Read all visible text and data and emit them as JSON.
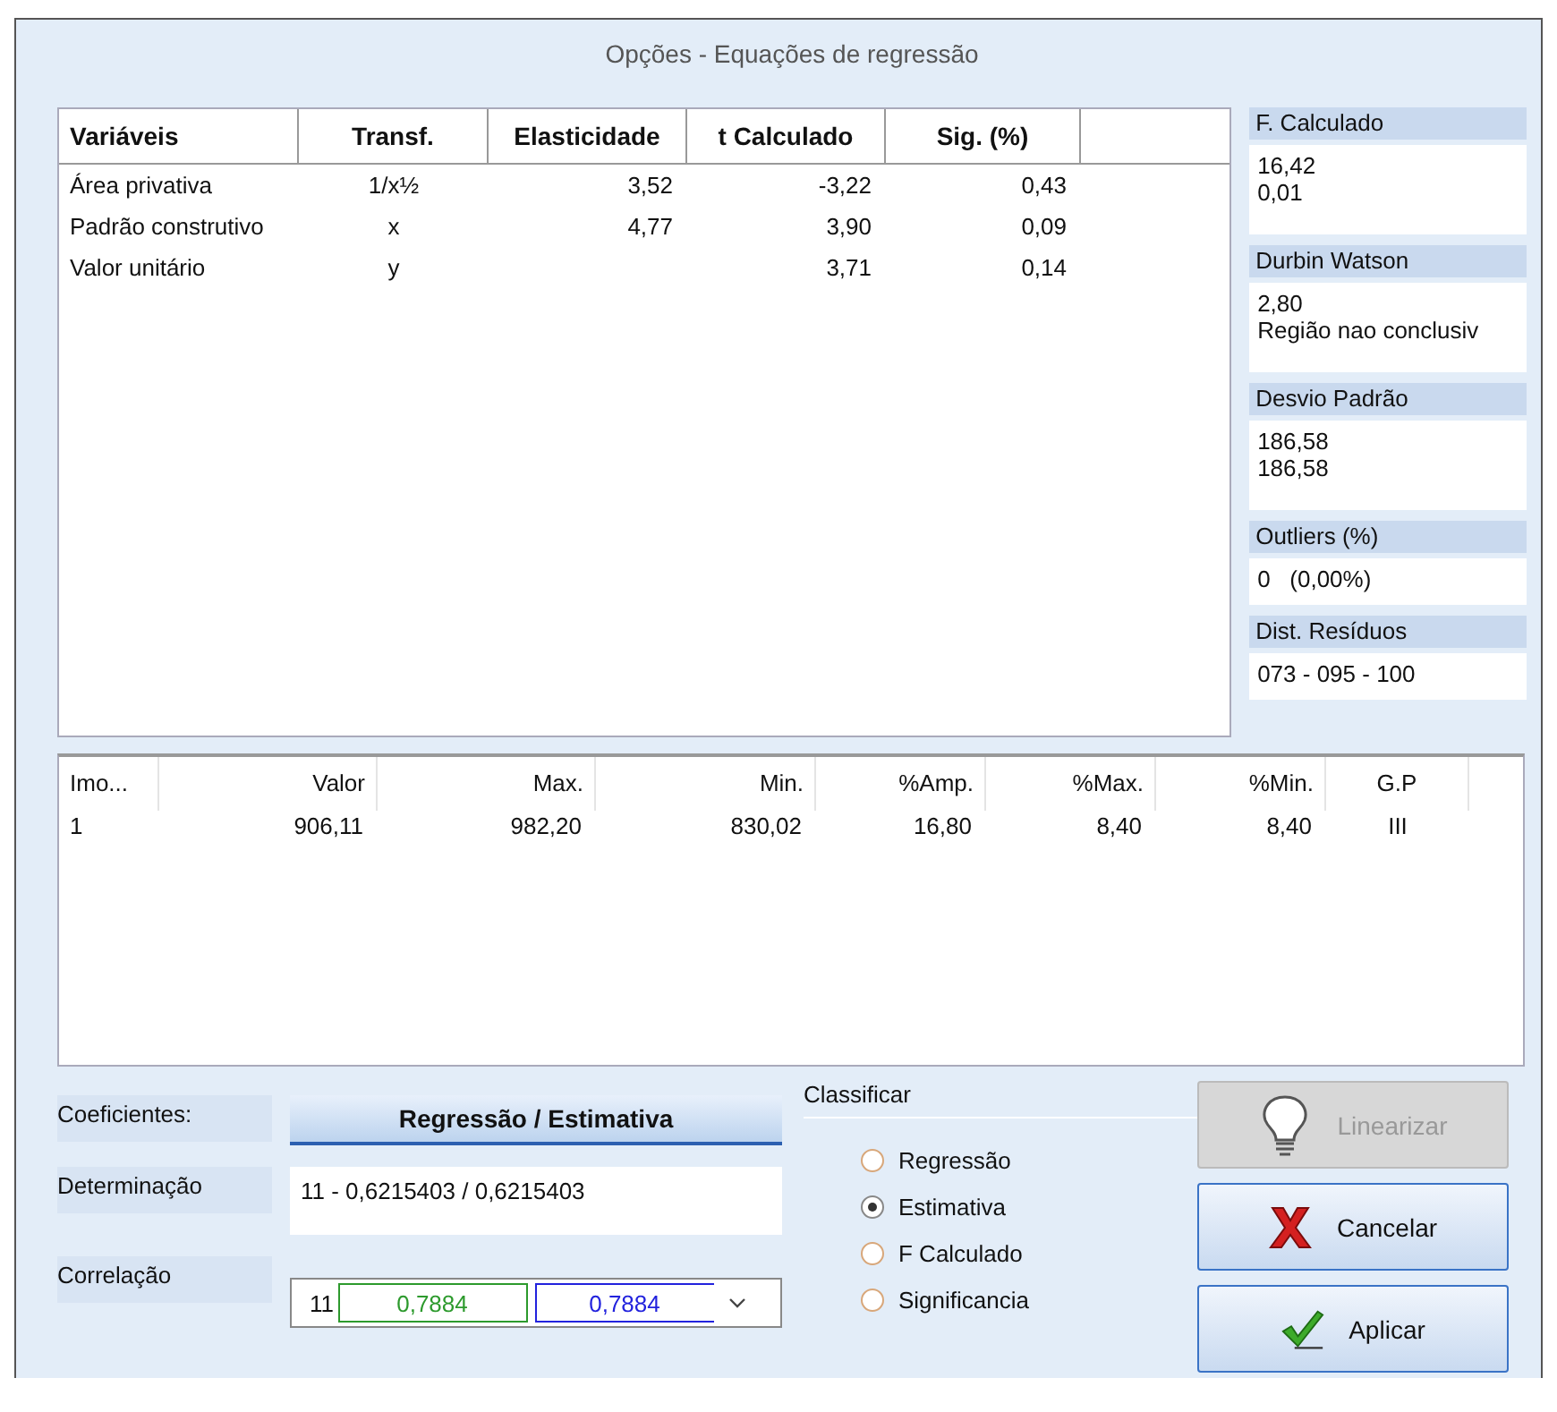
{
  "window": {
    "title": "Opções - Equações de regressão"
  },
  "variables_table": {
    "columns": [
      "Variáveis",
      "Transf.",
      "Elasticidade",
      "t Calculado",
      "Sig. (%)"
    ],
    "rows": [
      [
        "Área privativa",
        "1/x½",
        "3,52",
        "-3,22",
        "0,43"
      ],
      [
        "Padrão construtivo",
        "x",
        "4,77",
        "3,90",
        "0,09"
      ],
      [
        "Valor unitário",
        "y",
        null,
        "3,71",
        "0,14"
      ]
    ]
  },
  "stats": [
    {
      "label": "F. Calculado",
      "lines": [
        "16,42",
        "0,01"
      ]
    },
    {
      "label": "Durbin Watson",
      "lines": [
        "2,80",
        "Região nao conclusiv"
      ]
    },
    {
      "label": "Desvio Padrão",
      "lines": [
        "186,58",
        "186,58"
      ]
    },
    {
      "label": "Outliers (%)",
      "lines": [
        "0   (0,00%)"
      ]
    },
    {
      "label": "Dist. Resíduos",
      "lines": [
        "073 - 095 - 100"
      ]
    }
  ],
  "estimate_table": {
    "columns": [
      "Imo...",
      "Valor",
      "Max.",
      "Min.",
      "%Amp.",
      "%Max.",
      "%Min.",
      "G.P"
    ],
    "rows": [
      [
        "1",
        "906,11",
        "982,20",
        "830,02",
        "16,80",
        "8,40",
        "8,40",
        "III"
      ]
    ]
  },
  "coefficients": {
    "label": "Coeficientes:",
    "header": "Regressão / Estimativa",
    "determination_label": "Determinação",
    "determination_value": "11 -  0,6215403  /  0,6215403",
    "correlation_label": "Correlação",
    "correlation": {
      "prefix": "11",
      "value_1": "0,7884",
      "value_2": "0,7884"
    }
  },
  "classify": {
    "title": "Classificar",
    "options": [
      {
        "label": "Regressão",
        "selected": false
      },
      {
        "label": "Estimativa",
        "selected": true
      },
      {
        "label": "F Calculado",
        "selected": false
      },
      {
        "label": "Significancia",
        "selected": false
      }
    ]
  },
  "buttons": [
    {
      "label": "Linearizar",
      "kind": "bulb",
      "disabled": true
    },
    {
      "label": "Cancelar",
      "kind": "cancel",
      "disabled": false
    },
    {
      "label": "Aplicar",
      "kind": "apply",
      "disabled": false
    }
  ]
}
